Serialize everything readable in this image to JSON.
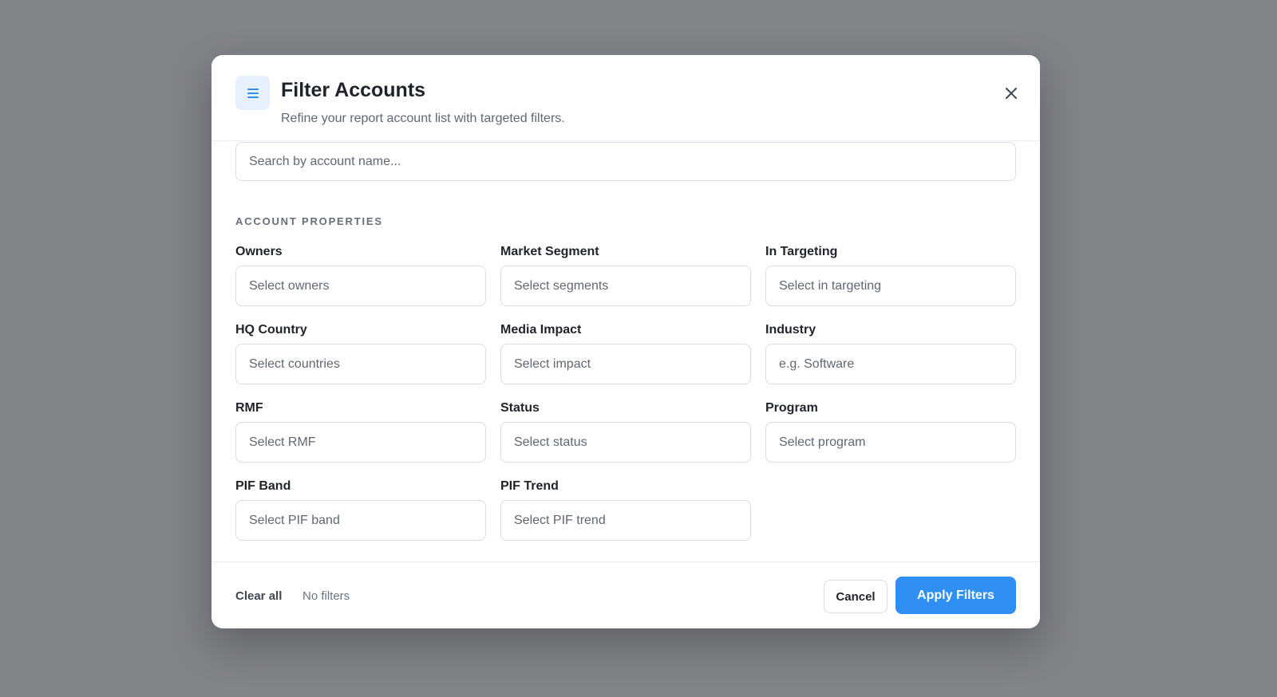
{
  "modal": {
    "icon": "filter-lines-icon",
    "title": "Filter Accounts",
    "subtitle": "Refine your report account list with targeted filters.",
    "close_icon": "close-icon"
  },
  "search": {
    "placeholder": "Search by account name..."
  },
  "section": {
    "title": "ACCOUNT PROPERTIES"
  },
  "fields": [
    {
      "label": "Owners",
      "placeholder": "Select owners"
    },
    {
      "label": "Market Segment",
      "placeholder": "Select segments"
    },
    {
      "label": "In Targeting",
      "placeholder": "Select in targeting"
    },
    {
      "label": "HQ Country",
      "placeholder": "Select countries"
    },
    {
      "label": "Media Impact",
      "placeholder": "Select impact"
    },
    {
      "label": "Industry",
      "placeholder": "e.g. Software"
    },
    {
      "label": "RMF",
      "placeholder": "Select RMF"
    },
    {
      "label": "Status",
      "placeholder": "Select status"
    },
    {
      "label": "Program",
      "placeholder": "Select program"
    },
    {
      "label": "PIF Band",
      "placeholder": "Select PIF band"
    },
    {
      "label": "PIF Trend",
      "placeholder": "Select PIF trend"
    }
  ],
  "footer": {
    "clear_label": "Clear all",
    "filter_count": "No filters",
    "cancel_label": "Cancel",
    "apply_label": "Apply Filters"
  },
  "colors": {
    "accent": "#2f8ff2",
    "backdrop": "#808388",
    "icon_bg": "#e6f0fe"
  }
}
